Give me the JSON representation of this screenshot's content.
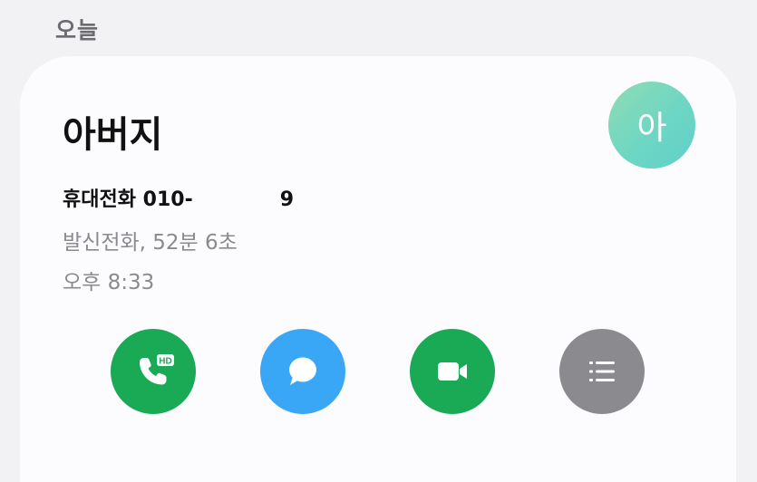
{
  "section": {
    "label": "오늘"
  },
  "contact": {
    "name": "아버지",
    "avatar_initial": "아",
    "phone_type": "휴대전화",
    "phone_prefix": "010-",
    "phone_suffix": "9",
    "call_detail": "발신전화, 52분 6초",
    "call_time": "오후 8:33"
  },
  "actions": {
    "call_badge": "HD",
    "call_icon": "phone-hd-icon",
    "message_icon": "message-bubble-icon",
    "video_icon": "video-camera-icon",
    "details_icon": "list-icon"
  },
  "colors": {
    "background": "#f2f2f4",
    "card": "#fcfcfe",
    "green": "#1aaa55",
    "blue": "#39a7f5",
    "gray": "#8a8a8f",
    "avatar": "#6ed6c3"
  }
}
